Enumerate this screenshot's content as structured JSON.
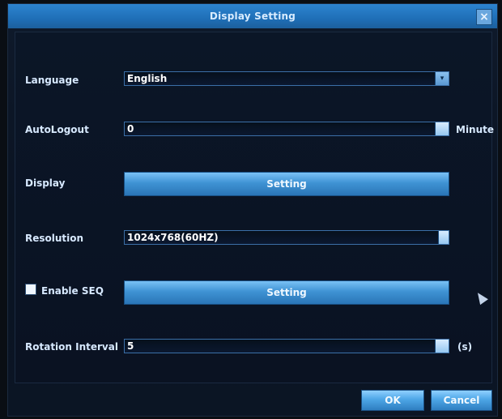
{
  "window": {
    "title": "Display Setting",
    "close_label": "×"
  },
  "form": {
    "language": {
      "label": "Language",
      "value": "English",
      "dropdown_icon": "dropdown-icon"
    },
    "autologout": {
      "label": "AutoLogout",
      "value": "0",
      "unit": "Minute"
    },
    "display": {
      "label": "Display",
      "button_label": "Setting"
    },
    "resolution": {
      "label": "Resolution",
      "value": "1024x768(60HZ)"
    },
    "enable_seq": {
      "label": "Enable SEQ",
      "checked": false,
      "button_label": "Setting"
    },
    "rotation_interval": {
      "label": "Rotation Interval",
      "value": "5",
      "unit": "(s)"
    }
  },
  "footer": {
    "ok_label": "OK",
    "cancel_label": "Cancel"
  },
  "colors": {
    "title_bar": "#2d84cf",
    "button_blue": "#3f93d4",
    "background": "#0a1222",
    "text": "#d7e9ff"
  }
}
